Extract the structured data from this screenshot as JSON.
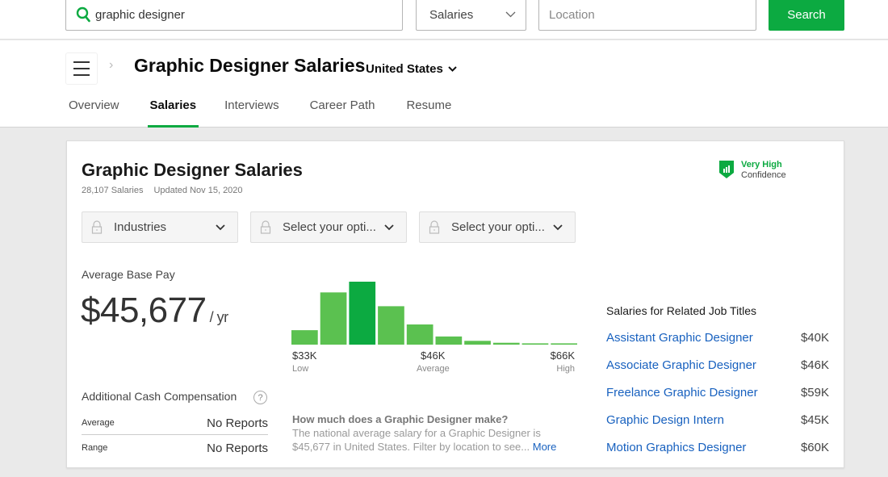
{
  "search": {
    "query": "graphic designer",
    "type_select": "Salaries",
    "location_placeholder": "Location",
    "button_label": "Search"
  },
  "header": {
    "title": "Graphic Designer Salaries",
    "country": "United States",
    "tabs": [
      {
        "label": "Overview",
        "active": false
      },
      {
        "label": "Salaries",
        "active": true
      },
      {
        "label": "Interviews",
        "active": false
      },
      {
        "label": "Career Path",
        "active": false
      },
      {
        "label": "Resume",
        "active": false
      }
    ]
  },
  "card": {
    "title": "Graphic Designer Salaries",
    "salary_count": "28,107 Salaries",
    "updated": "Updated Nov 15, 2020",
    "confidence": {
      "level": "Very High",
      "label": "Confidence"
    },
    "filters": [
      {
        "label": "Industries"
      },
      {
        "label": "Select your opti..."
      },
      {
        "label": "Select your opti..."
      }
    ],
    "average_base_pay": {
      "label": "Average Base Pay",
      "value": "$45,677",
      "unit": "/ yr"
    },
    "additional_cash": {
      "title": "Additional Cash Compensation",
      "help": "?",
      "rows": [
        {
          "key": "Average",
          "value": "No Reports"
        },
        {
          "key": "Range",
          "value": "No Reports"
        }
      ]
    },
    "faq": {
      "question": "How much does a Graphic Designer make?",
      "answer": "The national average salary for a Graphic Designer is $45,677 in United States. Filter by location to see...",
      "more": "More"
    },
    "related": {
      "title": "Salaries for Related Job Titles",
      "items": [
        {
          "title": "Assistant Graphic Designer",
          "salary": "$40K"
        },
        {
          "title": "Associate Graphic Designer",
          "salary": "$46K"
        },
        {
          "title": "Freelance Graphic Designer",
          "salary": "$59K"
        },
        {
          "title": "Graphic Design Intern",
          "salary": "$45K"
        },
        {
          "title": "Motion Graphics Designer",
          "salary": "$60K"
        }
      ]
    }
  },
  "colors": {
    "brand_green": "#0caa41",
    "bar_green": "#5bc150",
    "link_blue": "#1861bf"
  },
  "chart_data": {
    "type": "bar",
    "title": "",
    "categories": [
      "1",
      "2",
      "3",
      "4",
      "5",
      "6",
      "7",
      "8",
      "9",
      "10"
    ],
    "values": [
      0.23,
      0.83,
      1.0,
      0.61,
      0.32,
      0.13,
      0.06,
      0.03,
      0.02,
      0.02
    ],
    "highlight_index": 2,
    "ylim": [
      0,
      1
    ],
    "tick_labels": [
      {
        "value": "$33K",
        "sub": "Low"
      },
      {
        "value": "$46K",
        "sub": "Average"
      },
      {
        "value": "$66K",
        "sub": "High"
      }
    ],
    "xlabel": "",
    "ylabel": "",
    "grid": false
  }
}
